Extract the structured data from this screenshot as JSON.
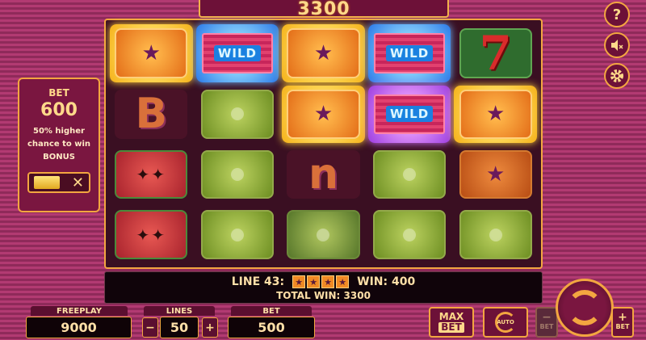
{
  "top": {
    "win": "3300"
  },
  "bet_panel": {
    "label": "BET",
    "value": "600",
    "desc_line1": "50% higher",
    "desc_line2": "chance to win",
    "desc_line3": "BONUS",
    "toggle_off": "✕"
  },
  "side_buttons": {
    "help": "?",
    "sound_icon": "speaker-muted-icon",
    "settings_icon": "gear-icon"
  },
  "reels": [
    [
      "star",
      "wild",
      "star",
      "wild",
      "seven"
    ],
    [
      "B",
      "lime",
      "star",
      "wild",
      "star"
    ],
    [
      "melon",
      "lime",
      "n",
      "lime",
      "star-dim"
    ],
    [
      "melon",
      "lime",
      "kiwi",
      "lime",
      "lime"
    ]
  ],
  "symbols": {
    "wild": "WILD",
    "seven": "7",
    "star": "★",
    "B": "B",
    "n": "n"
  },
  "info": {
    "line_label": "LINE 43:",
    "win_label": "WIN: 400",
    "total_label": "TOTAL WIN: 3300"
  },
  "controls": {
    "freeplay_label": "FREEPLAY",
    "freeplay_value": "9000",
    "lines_label": "LINES",
    "lines_value": "50",
    "bet_label": "BET",
    "bet_value": "500",
    "minus": "−",
    "plus": "+",
    "max_line1": "MAX",
    "max_line2": "BET",
    "auto_label": "AUTO",
    "bet_minus_label": "BET",
    "bet_plus_label": "BET"
  },
  "colors": {
    "accent": "#f3a640",
    "panel": "#6d1138",
    "text_gold": "#ffd98a"
  }
}
